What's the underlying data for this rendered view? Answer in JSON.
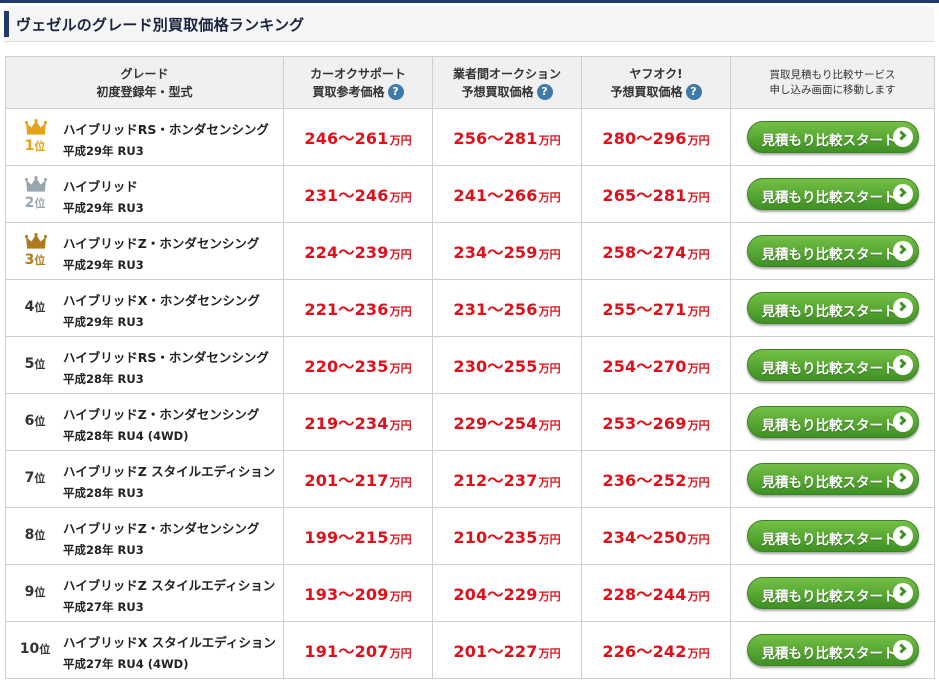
{
  "page": {
    "title": "ヴェゼルのグレード別買取価格ランキング"
  },
  "colors": {
    "accent": "#1f3b6b",
    "price": "#e0101a",
    "button": "#4fa52e",
    "gold": "#e3a21a",
    "silver": "#9aa7b0",
    "bronze": "#b07a1e"
  },
  "table": {
    "header": {
      "grade_line1": "グレード",
      "grade_line2": "初度登録年・型式",
      "col1_line1": "カーオクサポート",
      "col1_line2": "買取参考価格",
      "col2_line1": "業者間オークション",
      "col2_line2": "予想買取価格",
      "col3_line1": "ヤフオク!",
      "col3_line2": "予想買取価格",
      "col4_line1": "買取見積もり比較サービス",
      "col4_line2": "申し込み画面に移動します",
      "help_icon": "question-mark-icon",
      "help_text": "?"
    },
    "unit": "万円",
    "button_label": "見積もり比較スタート",
    "rows": [
      {
        "rank": "1",
        "suffix": "位",
        "medal": "gold",
        "grade": "ハイブリッドRS・ホンダセンシング",
        "year_model": "平成29年 RU3",
        "p1": "246〜261",
        "p2": "256〜281",
        "p3": "280〜296"
      },
      {
        "rank": "2",
        "suffix": "位",
        "medal": "silver",
        "grade": "ハイブリッド",
        "year_model": "平成29年 RU3",
        "p1": "231〜246",
        "p2": "241〜266",
        "p3": "265〜281"
      },
      {
        "rank": "3",
        "suffix": "位",
        "medal": "bronze",
        "grade": "ハイブリッドZ・ホンダセンシング",
        "year_model": "平成29年 RU3",
        "p1": "224〜239",
        "p2": "234〜259",
        "p3": "258〜274"
      },
      {
        "rank": "4",
        "suffix": "位",
        "medal": "none",
        "grade": "ハイブリッドX・ホンダセンシング",
        "year_model": "平成29年 RU3",
        "p1": "221〜236",
        "p2": "231〜256",
        "p3": "255〜271"
      },
      {
        "rank": "5",
        "suffix": "位",
        "medal": "none",
        "grade": "ハイブリッドRS・ホンダセンシング",
        "year_model": "平成28年 RU3",
        "p1": "220〜235",
        "p2": "230〜255",
        "p3": "254〜270"
      },
      {
        "rank": "6",
        "suffix": "位",
        "medal": "none",
        "grade": "ハイブリッドZ・ホンダセンシング",
        "year_model": "平成28年 RU4 (4WD)",
        "p1": "219〜234",
        "p2": "229〜254",
        "p3": "253〜269"
      },
      {
        "rank": "7",
        "suffix": "位",
        "medal": "none",
        "grade": "ハイブリッドZ スタイルエディション",
        "year_model": "平成28年 RU3",
        "p1": "201〜217",
        "p2": "212〜237",
        "p3": "236〜252"
      },
      {
        "rank": "8",
        "suffix": "位",
        "medal": "none",
        "grade": "ハイブリッドZ・ホンダセンシング",
        "year_model": "平成28年 RU3",
        "p1": "199〜215",
        "p2": "210〜235",
        "p3": "234〜250"
      },
      {
        "rank": "9",
        "suffix": "位",
        "medal": "none",
        "grade": "ハイブリッドZ スタイルエディション",
        "year_model": "平成27年 RU3",
        "p1": "193〜209",
        "p2": "204〜229",
        "p3": "228〜244"
      },
      {
        "rank": "10",
        "suffix": "位",
        "medal": "none",
        "grade": "ハイブリッドX スタイルエディション",
        "year_model": "平成27年 RU4 (4WD)",
        "p1": "191〜207",
        "p2": "201〜227",
        "p3": "226〜242"
      }
    ]
  }
}
